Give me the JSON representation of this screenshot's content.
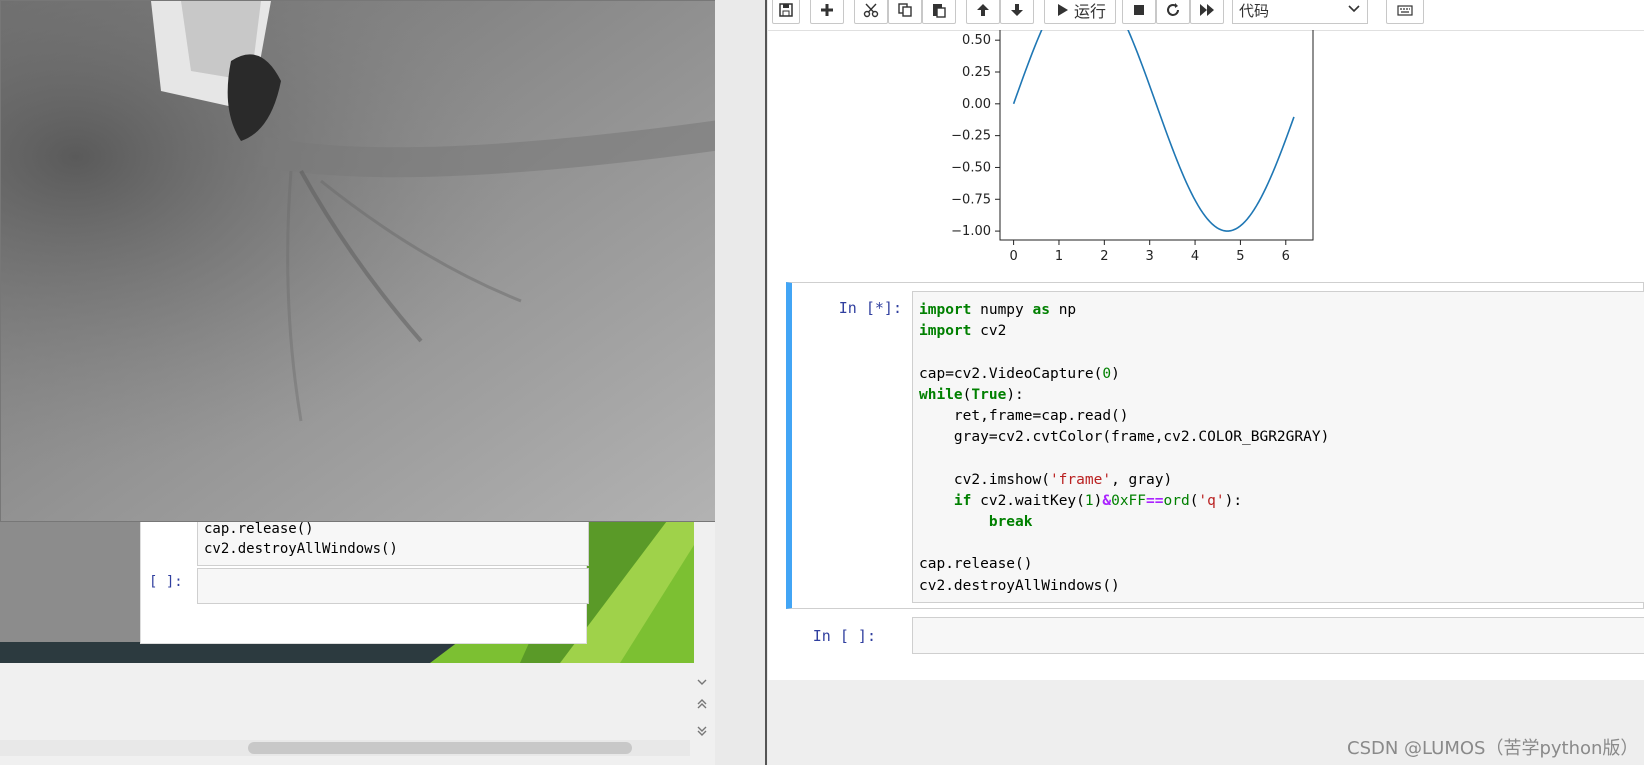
{
  "toolbar": {
    "run_label": "运行",
    "cell_type": "代码"
  },
  "plot": {
    "y_ticks": [
      "0.50",
      "0.25",
      "0.00",
      "−0.25",
      "−0.50",
      "−0.75",
      "−1.00"
    ],
    "x_ticks": [
      "0",
      "1",
      "2",
      "3",
      "4",
      "5",
      "6"
    ]
  },
  "cell1": {
    "prompt": "In  [*]:",
    "code": [
      [
        "kw:import",
        " numpy ",
        "kw:as",
        " np"
      ],
      [
        "kw:import",
        " cv2"
      ],
      [
        ""
      ],
      [
        "cap=cv2.VideoCapture(",
        "num:0",
        ")"
      ],
      [
        "kw:while",
        "(",
        "kw:True",
        "):"
      ],
      [
        "    ret,frame=cap.read()"
      ],
      [
        "    gray=cv2.cvtColor(frame,cv2.COLOR_BGR2GRAY)"
      ],
      [
        ""
      ],
      [
        "    cv2.imshow(",
        "str:'frame'",
        ", gray)"
      ],
      [
        "    ",
        "kw:if",
        " cv2.waitKey(",
        "num:1",
        ")",
        "op:&",
        "num:0xFF",
        "op:==",
        "bi:ord",
        "(",
        "str:'q'",
        "):"
      ],
      [
        "        ",
        "kw:break"
      ],
      [
        ""
      ],
      [
        "cap.release()"
      ],
      [
        "cv2.destroyAllWindows()"
      ]
    ]
  },
  "cell2": {
    "prompt": "In  [ ]:"
  },
  "left_window": {
    "partial_code_1": "cap.release()",
    "partial_code_2": "cv2.destroyAllWindows()",
    "prompt": "[ ]:"
  },
  "watermark": "CSDN @LUMOS（苦学python版）",
  "colors": {
    "accent": "#42a5f5",
    "plot_line": "#1f77b4",
    "slide_green": "#7cc032"
  }
}
